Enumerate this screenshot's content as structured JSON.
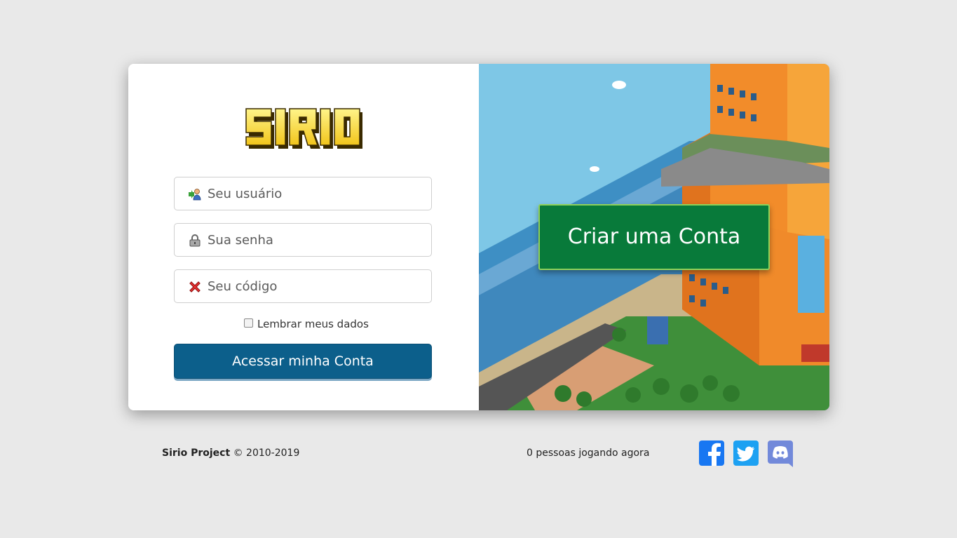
{
  "brand": {
    "logo_text": "SIRIO"
  },
  "login": {
    "username_placeholder": "Seu usuário",
    "password_placeholder": "Sua senha",
    "code_placeholder": "Seu código",
    "remember_label": "Lembrar meus dados",
    "submit_label": "Acessar minha Conta"
  },
  "register": {
    "label": "Criar uma Conta"
  },
  "footer": {
    "brand": "Sirio Project",
    "copyright": " © 2010-2019",
    "online_text": "0 pessoas jogando agora",
    "social": [
      "facebook-icon",
      "twitter-icon",
      "discord-icon"
    ]
  },
  "colors": {
    "background": "#e9e9e9",
    "login_button": "#0c5f8b",
    "register_button": "#087a3a",
    "facebook": "#1877f2",
    "twitter": "#1da1f2",
    "discord": "#7289da"
  }
}
